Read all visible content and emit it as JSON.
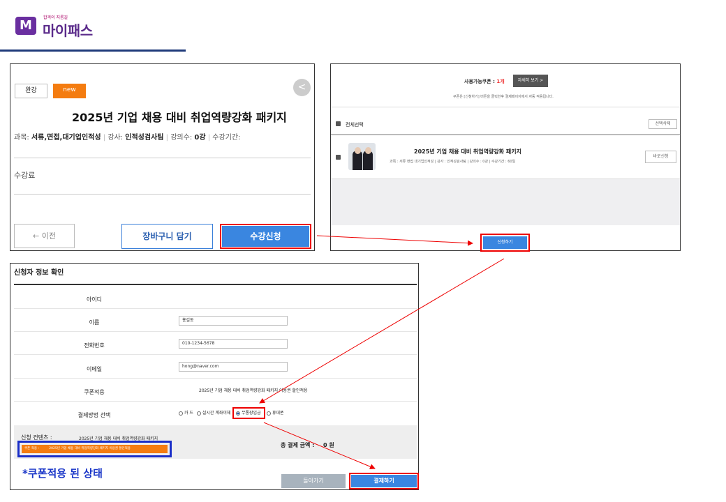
{
  "logo": {
    "mark": "M",
    "tagline": "합격의 지름길",
    "name": "마이패스"
  },
  "course": {
    "badge_done": "완강",
    "badge_new": "new",
    "title": "2025년 기업 채용 대비 취업역량강화 패키지",
    "meta_subject_label": "과목: ",
    "meta_subject": "서류,면접,대기업인적성",
    "meta_teacher_label": "강사: ",
    "meta_teacher": "인적성검사팀",
    "meta_count_label": "강의수: ",
    "meta_count": "0강",
    "meta_period": "수강기간:",
    "fee_label": "수강료",
    "prev_button": "← 이전",
    "cart_button": "장바구니 담기",
    "apply_button": "수강신청"
  },
  "cart": {
    "coupon_label": "사용가능쿠폰 : ",
    "coupon_count": "1개",
    "detail_button": "자세히 보기 >",
    "coupon_note": "쿠폰은 [신청하기] 버튼을 클릭한후 결제페이지에서 자동 적용됩니다.",
    "select_all": "전체선택",
    "delete_selected": "선택삭제",
    "item_title": "2025년 기업 채용 대비 취업역량강화 패키지",
    "item_meta": "과목 : 서류 면접 대기업인적성 | 강사 : 인적성검사팀 | 강의수 : 0강 | 수강기간 : 60일",
    "buy_now": "바로신청",
    "apply_button": "신청하기"
  },
  "checkout": {
    "section_title": "신청자 정보 확인",
    "fields": [
      {
        "label": "아이디",
        "value": ""
      },
      {
        "label": "이름",
        "value": "홍길동"
      },
      {
        "label": "전화번호",
        "value": "010-1234-5678"
      },
      {
        "label": "이메일",
        "value": "hong@naver.com"
      }
    ],
    "coupon_label": "쿠폰적용",
    "coupon_value": "2025년 기업 채용 대비 취업역량강화 패키지 이용권 할인적용",
    "pay_label": "결제방법 선택",
    "pay_options": [
      "카 드",
      "실시간 계좌이체",
      "무통장입금",
      "휴대폰"
    ],
    "selected_option": "무통장입금",
    "contents_label": "신청 컨텐츠 :",
    "contents_value": "2025년 기업 채용 대비 취업역량강화 패키지",
    "coupon_tag_label": "쿠폰 적용 :",
    "coupon_tag_value": "2025년 기업 채용 대비 취업역량강화 패키지 이용권 할인적용",
    "total_label": "총 결제 금액 :",
    "total_value": "0 원",
    "back_button": "돌아가기",
    "pay_button": "결제하기"
  },
  "annotation": "*쿠폰적용 된 상태",
  "colors": {
    "accent_red": "#e00000",
    "brand_blue": "#3a86e0",
    "logo_purple": "#6a2fa0",
    "coupon_orange": "#f47c10"
  }
}
